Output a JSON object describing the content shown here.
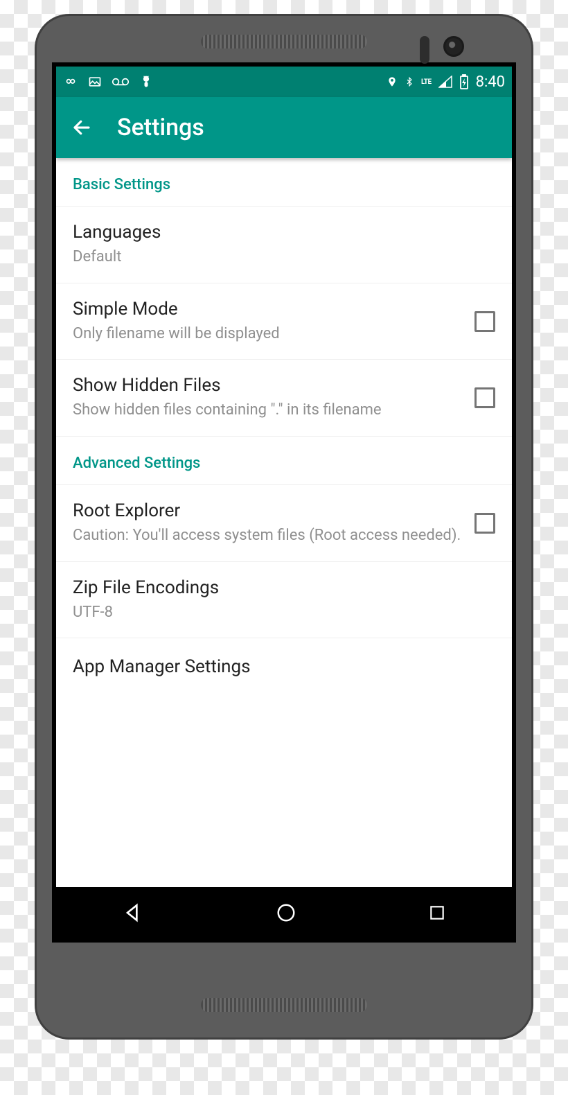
{
  "status": {
    "time": "8:40"
  },
  "appbar": {
    "title": "Settings"
  },
  "sections": {
    "basic": {
      "title": "Basic Settings"
    },
    "advanced": {
      "title": "Advanced Settings"
    },
    "appmgr": {
      "title": "App Manager Settings"
    }
  },
  "prefs": {
    "languages": {
      "title": "Languages",
      "sub": "Default"
    },
    "simple_mode": {
      "title": "Simple Mode",
      "sub": "Only filename will be displayed"
    },
    "show_hidden": {
      "title": "Show Hidden Files",
      "sub": "Show hidden files containing \".\" in its filename"
    },
    "root_explorer": {
      "title": "Root Explorer",
      "sub": "Caution: You'll access system files (Root access needed)."
    },
    "zip_encoding": {
      "title": "Zip File Encodings",
      "sub": "UTF-8"
    }
  }
}
